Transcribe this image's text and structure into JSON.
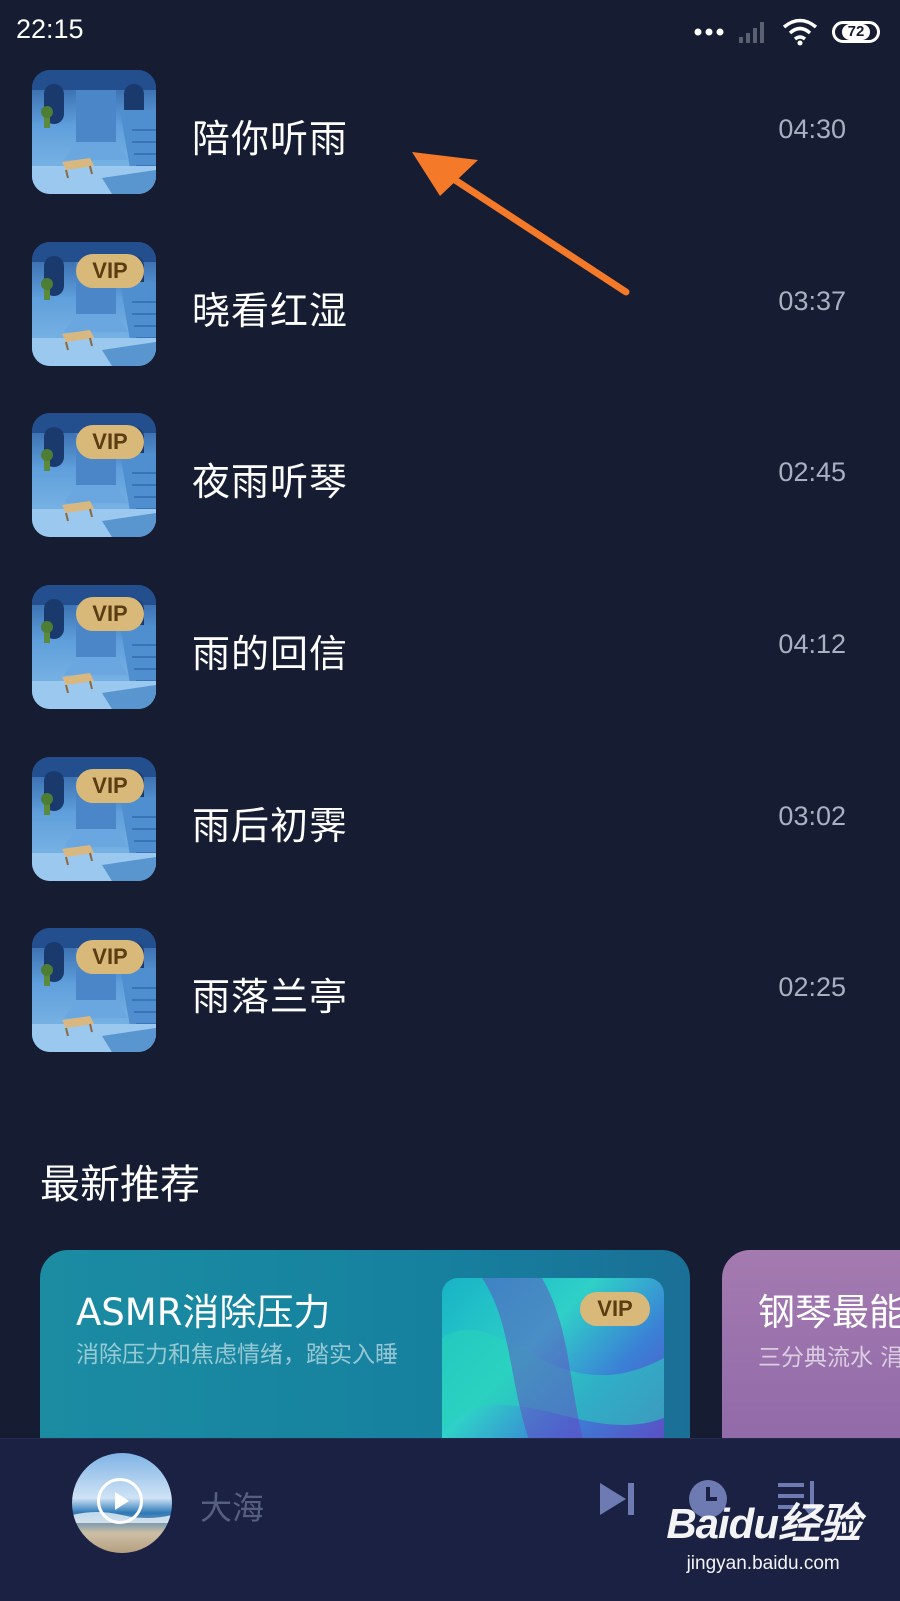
{
  "status_bar": {
    "time": "22:15",
    "battery": "72",
    "icons": [
      "dots-icon",
      "signal-icon",
      "wifi-icon",
      "battery-icon"
    ]
  },
  "tracks": [
    {
      "title": "陪你听雨",
      "duration": "04:30",
      "vip": false
    },
    {
      "title": "晓看红湿",
      "duration": "03:37",
      "vip": true,
      "badge": "VIP"
    },
    {
      "title": "夜雨听琴",
      "duration": "02:45",
      "vip": true,
      "badge": "VIP"
    },
    {
      "title": "雨的回信",
      "duration": "04:12",
      "vip": true,
      "badge": "VIP"
    },
    {
      "title": "雨后初霁",
      "duration": "03:02",
      "vip": true,
      "badge": "VIP"
    },
    {
      "title": "雨落兰亭",
      "duration": "02:25",
      "vip": true,
      "badge": "VIP"
    }
  ],
  "section": {
    "title": "最新推荐"
  },
  "cards": [
    {
      "title": "ASMR消除压力",
      "desc": "消除压力和焦虑情绪，踏实入睡",
      "badge": "VIP"
    },
    {
      "title": "钢琴最能",
      "desc": "三分典流水 涓"
    }
  ],
  "player": {
    "title": "大海",
    "controls": [
      "next-icon",
      "timer-icon",
      "playlist-icon"
    ]
  },
  "watermark": {
    "logo": "Baidu经验",
    "url": "jingyan.baidu.com"
  },
  "colors": {
    "background": "#161c31",
    "vip_badge": "#d9b97a",
    "annotation_arrow": "#f47a2a",
    "player_bar": "#1a2142"
  }
}
